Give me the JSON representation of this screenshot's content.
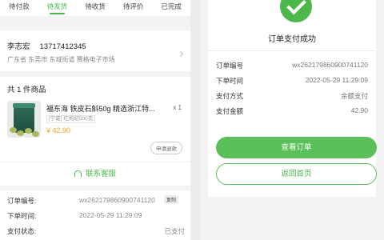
{
  "tabs": [
    {
      "label": "待付款"
    },
    {
      "label": "待发货"
    },
    {
      "label": "待收货"
    },
    {
      "label": "待评价"
    },
    {
      "label": "已完成"
    }
  ],
  "address": {
    "name": "李志宏",
    "phone": "13717412345",
    "line": "广东省 东莞市 东城街道 赛格电子市场"
  },
  "goods": {
    "header": "共 1 件商品",
    "product_name": "福东海 铁皮石斛50g 精选浙江特...",
    "quantity": "x 1",
    "spec": "[宁夏] 红枸杞500克",
    "price": "¥ 42.90",
    "refund_label": "申请退款",
    "service_label": "联系客服"
  },
  "order_info": {
    "order_no_label": "订单编号:",
    "order_no": "wx262179860900741120",
    "copy_label": "复制",
    "time_label": "下单时间:",
    "time": "2022-05-29 11:29:09",
    "status_label": "支付状态:",
    "status": "已支付"
  },
  "payment": {
    "title": "订单支付成功",
    "rows": [
      {
        "label": "订单编号",
        "value": "wx262179860900741120"
      },
      {
        "label": "下单时间",
        "value": "2022-05-29 11:29:09"
      },
      {
        "label": "支付方式",
        "value": "余额支付"
      },
      {
        "label": "支付金额",
        "value": "42.90"
      }
    ],
    "view_order_label": "查看订单",
    "back_home_label": "返回首页"
  },
  "colors": {
    "accent": "#4cb84a",
    "price": "#f0a323"
  }
}
